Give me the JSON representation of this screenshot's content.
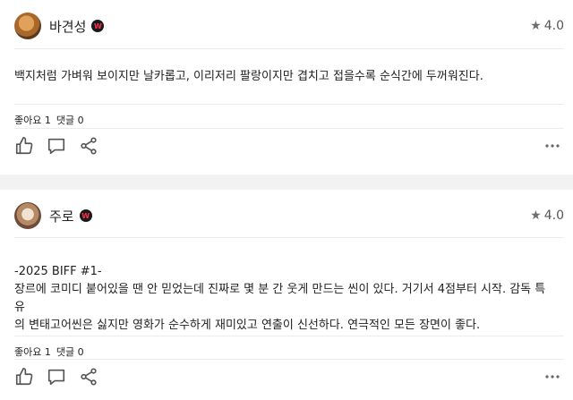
{
  "reviews": [
    {
      "user": "바견성",
      "badge": "W",
      "rating": "4.0",
      "text_lines": [
        "백지처럼 가벼워 보이지만 날카롭고, 이리저리 팔랑이지만 겹치고 접을수록 순식간에 두꺼워진다."
      ],
      "likes": "좋아요 1",
      "comments": "댓글 0",
      "icons": [
        "star-icon",
        "like-icon",
        "comment-icon",
        "share-icon",
        "more-icon"
      ]
    },
    {
      "user": "주로",
      "badge": "W",
      "rating": "4.0",
      "text_lines": [
        "-2025 BIFF #1-",
        "장르에 코미디 붙어있을 땐 안 믿었는데 진짜로 몇 분 간 웃게 만드는 씬이 있다. 거기서 4점부터 시작. 감독 특유",
        "의 변태고어씬은 싫지만 영화가 순수하게 재미있고 연출이 신선하다. 연극적인 모든 장면이 좋다."
      ],
      "likes": "좋아요 1",
      "comments": "댓글 0",
      "icons": [
        "star-icon",
        "like-icon",
        "comment-icon",
        "share-icon",
        "more-icon"
      ]
    }
  ],
  "colors": {
    "background": "#f2f2f2",
    "card": "#ffffff",
    "badge_accent": "#ff2f4d",
    "icon": "#555555"
  }
}
